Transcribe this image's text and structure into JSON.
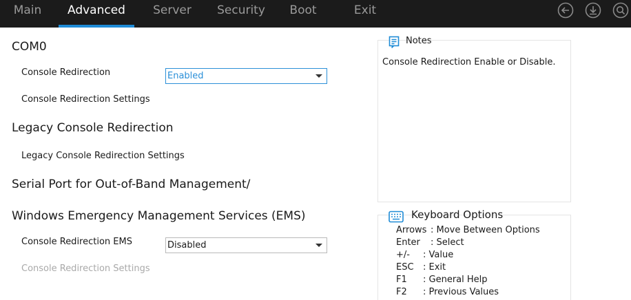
{
  "tabs": [
    {
      "label": "Main"
    },
    {
      "label": "Advanced",
      "active": true
    },
    {
      "label": "Server"
    },
    {
      "label": "Security"
    },
    {
      "label": "Boot"
    },
    {
      "label": "Exit"
    }
  ],
  "toolbar_icons": [
    "back-icon",
    "save-icon",
    "search-icon"
  ],
  "form": {
    "com0_title": "COM0",
    "console_redirection": {
      "label": "Console Redirection",
      "value": "Enabled"
    },
    "console_redirection_settings": "Console Redirection Settings",
    "legacy_title": "Legacy Console Redirection",
    "legacy_settings": "Legacy Console Redirection Settings",
    "serial_title": "Serial Port for Out-of-Band Management/",
    "ems_title": "Windows Emergency Management Services (EMS)",
    "console_redirection_ems": {
      "label": "Console Redirection EMS",
      "value": "Disabled"
    },
    "ems_settings": "Console Redirection Settings"
  },
  "notes": {
    "title": "Notes",
    "text": "Console Redirection Enable or Disable."
  },
  "keyboard": {
    "title": "Keyboard Options",
    "rows": [
      {
        "key": "Arrows",
        "desc": ": Move Between Options"
      },
      {
        "key": "Enter",
        "desc": ": Select"
      },
      {
        "key": "+/-",
        "desc": ": Value"
      },
      {
        "key": "ESC",
        "desc": ": Exit"
      },
      {
        "key": "F1",
        "desc": ": General Help"
      },
      {
        "key": "F2",
        "desc": ": Previous Values"
      }
    ]
  },
  "colors": {
    "accent": "#1e8bd6",
    "topbar": "#1b1b1b",
    "disabled_text": "#a9a9a9"
  }
}
